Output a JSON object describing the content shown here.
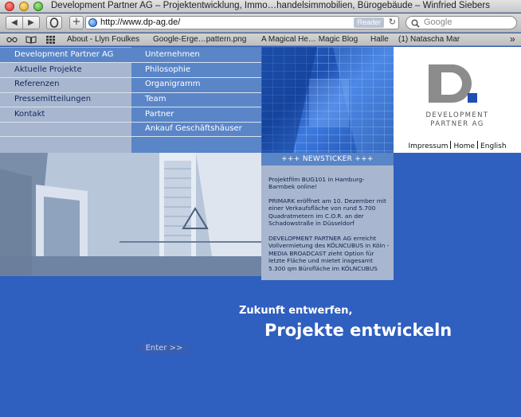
{
  "window": {
    "title": "Development Partner AG – Projektentwicklung, Immo…handelsimmobilien, Bürogebäude – Winfried Siebers"
  },
  "toolbar": {
    "back_icon": "◀",
    "forward_icon": "▶",
    "add_icon": "+",
    "url": "http://www.dp-ag.de/",
    "reader_label": "Reader",
    "reload_icon": "↻",
    "search_placeholder": "Google",
    "search_icon": "🔍"
  },
  "bookmarks": {
    "items": [
      "About - Llyn Foulkes",
      "Google-Erge…pattern.png",
      "A Magical He… Magic Blog",
      "Halle",
      "(1) Natascha Mar"
    ],
    "more_icon": "»"
  },
  "nav": {
    "left": [
      "Development Partner AG",
      "Aktuelle Projekte",
      "Referenzen",
      "Pressemitteilungen",
      "Kontakt"
    ],
    "right": [
      "Unternehmen",
      "Philosophie",
      "Organigramm",
      "Team",
      "Partner",
      "Ankauf Geschäftshäuser"
    ]
  },
  "logo": {
    "line1": "DEVELOPMENT",
    "line2": "PARTNER AG",
    "links": [
      "Impressum",
      "Home",
      "English"
    ]
  },
  "news": {
    "heading": "+++ NEWSTICKER +++",
    "items": [
      "Projektfilm BUG101 in Hamburg-Barmbek online!",
      "PRIMARK eröffnet am 10. Dezember mit einer Verkaufsfläche von rund 5.700 Quadratmetern im C.O.R. an der Schadowstraße in Düsseldorf",
      "DEVELOPMENT PARTNER AG erreicht Vollvermietung des KÖLNCUBUS in Köln - MEDIA BROADCAST zieht Option für letzte Fläche und mietet insgesamt 5.300 qm Bürofläche im KÖLNCUBUS"
    ]
  },
  "hero": {
    "tagline_small": "Zukunft entwerfen,",
    "tagline_big": "Projekte entwickeln",
    "enter_label": "Enter >>"
  },
  "colors": {
    "page_blue": "#2f5fbf",
    "nav_light": "#a8b7cf",
    "nav_mid": "#5a86c8",
    "logo_grey": "#8a8a8a",
    "logo_blue": "#1f4db3"
  }
}
